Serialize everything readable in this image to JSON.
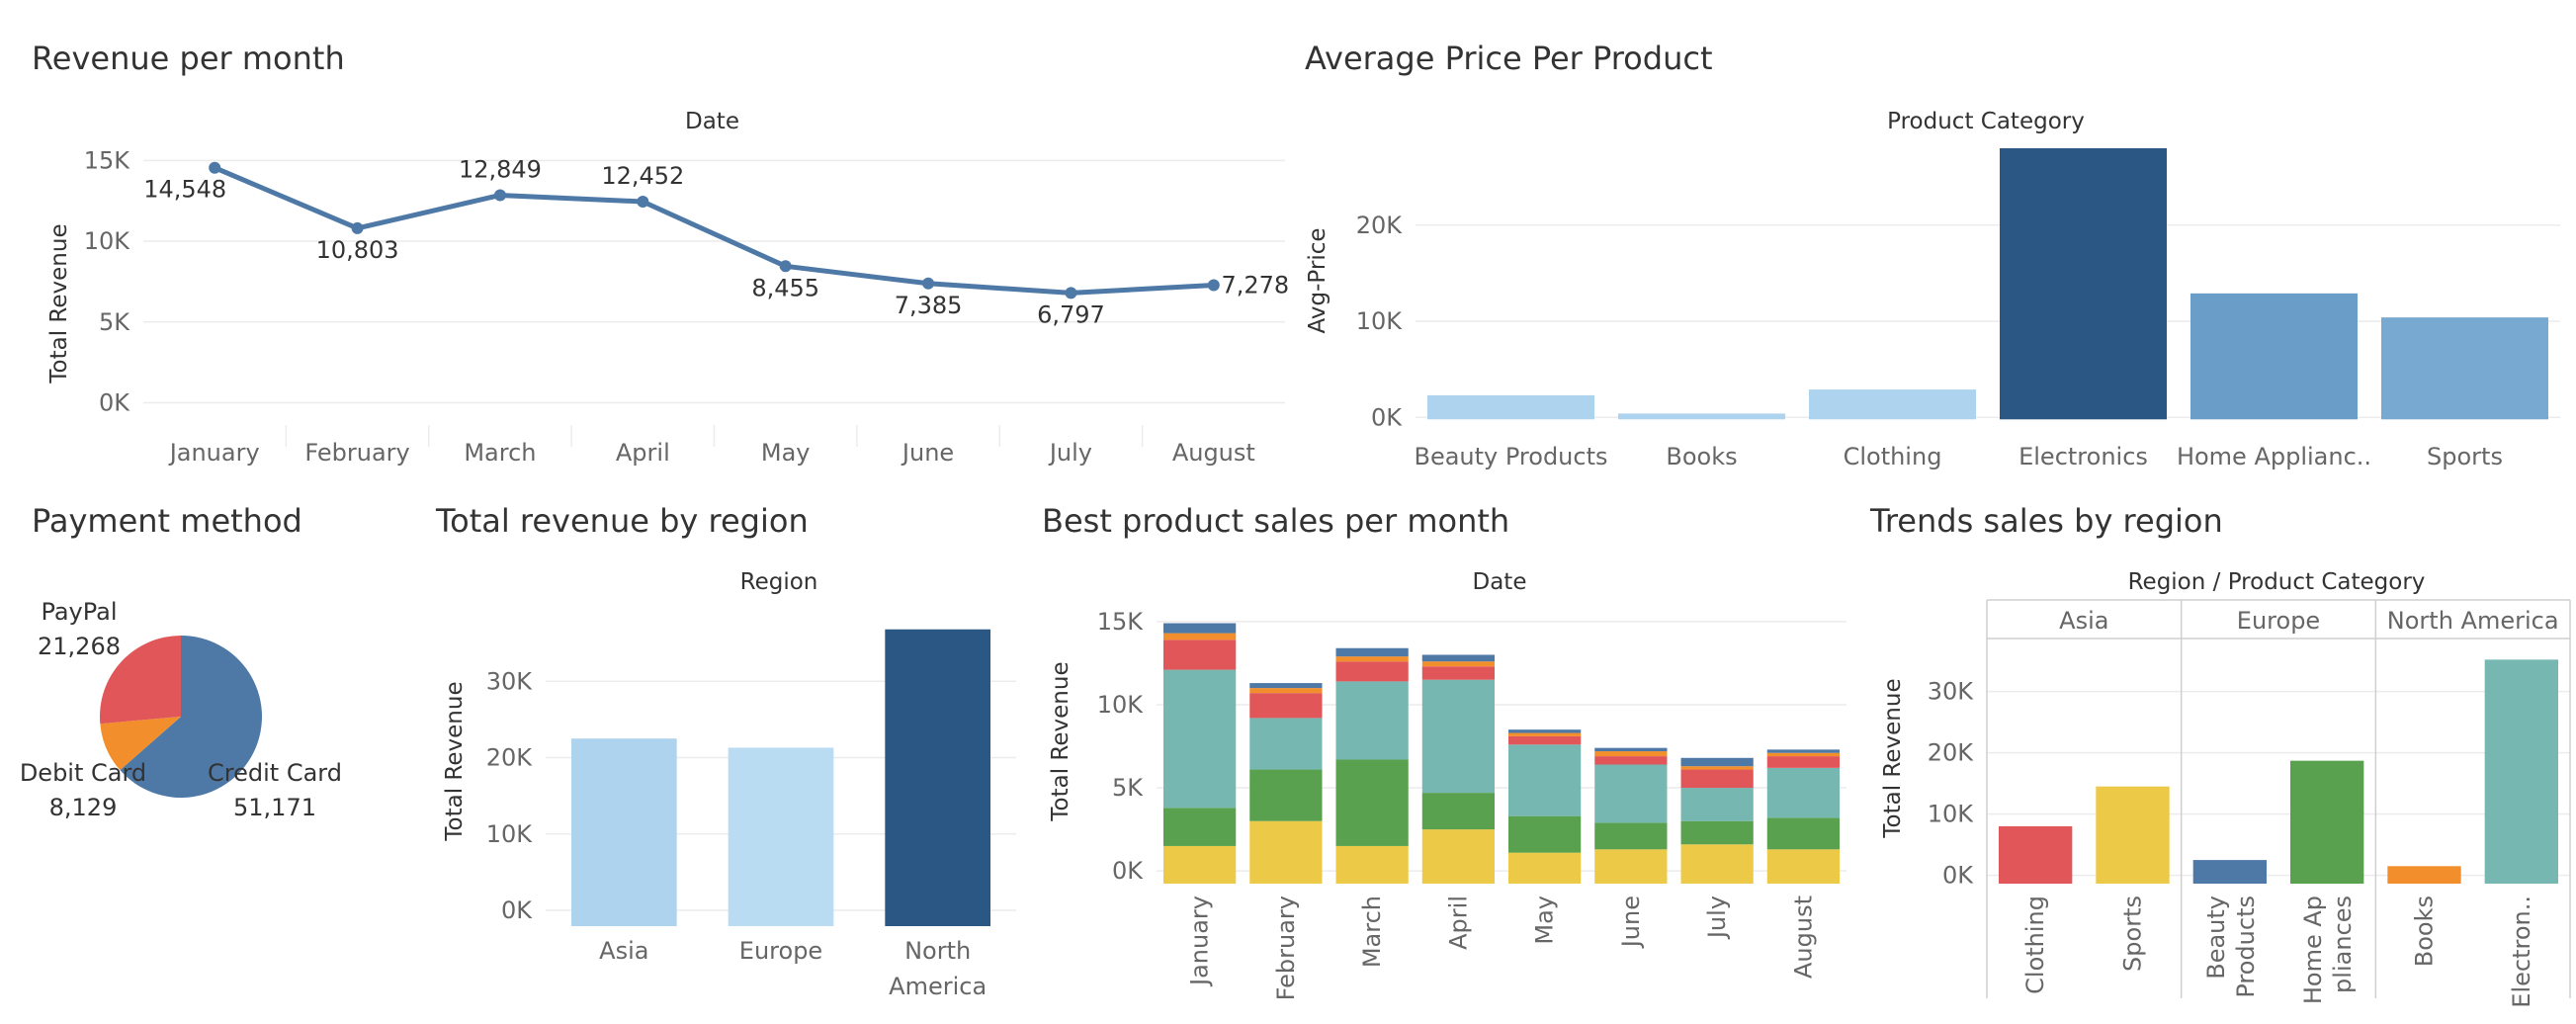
{
  "dashboard": {
    "colors": {
      "line": "#4e79a7",
      "dark_blue": "#2b5784",
      "mid_blue": "#6a9ec8",
      "light_blue": "#aed3ee",
      "grid": "#ececec",
      "pie_credit": "#4e79a7",
      "pie_debit": "#f28e2b",
      "pie_paypal": "#e15759"
    }
  },
  "chart_data": [
    {
      "id": "revenue-per-month",
      "type": "line",
      "title": "Revenue per month",
      "header": "Date",
      "ylabel": "Total Revenue",
      "categories": [
        "January",
        "February",
        "March",
        "April",
        "May",
        "June",
        "July",
        "August"
      ],
      "values": [
        14548,
        10803,
        12849,
        12452,
        8455,
        7385,
        6797,
        7278
      ],
      "labels": [
        "14,548",
        "10,803",
        "12,849",
        "12,452",
        "8,455",
        "7,385",
        "6,797",
        "7,278"
      ],
      "yticks": [
        "0K",
        "5K",
        "10K",
        "15K"
      ],
      "ylim": [
        -1500,
        16000
      ],
      "grid": true
    },
    {
      "id": "avg-price-per-product",
      "type": "bar",
      "title": "Average Price Per Product",
      "header": "Product Category",
      "ylabel": "Avg-Price",
      "categories": [
        "Beauty Products",
        "Books",
        "Clothing",
        "Electronics",
        "Home Applianc..",
        "Sports"
      ],
      "values": [
        2300,
        400,
        2900,
        28000,
        12900,
        10400
      ],
      "yticks": [
        "0K",
        "10K",
        "20K"
      ],
      "ylim": [
        -1000,
        28000
      ],
      "grid": true
    },
    {
      "id": "payment-method",
      "type": "pie",
      "title": "Payment method",
      "slices": [
        {
          "name": "Credit Card",
          "value": 51171,
          "label": "51,171"
        },
        {
          "name": "Debit Card",
          "value": 8129,
          "label": "8,129"
        },
        {
          "name": "PayPal",
          "value": 21268,
          "label": "21,268"
        }
      ]
    },
    {
      "id": "total-revenue-by-region",
      "type": "bar",
      "title": "Total revenue by region",
      "header": "Region",
      "ylabel": "Total Revenue",
      "categories": [
        "Asia",
        "Europe",
        "North America"
      ],
      "category_lines": [
        [
          "Asia"
        ],
        [
          "Europe"
        ],
        [
          "North",
          "America"
        ]
      ],
      "values": [
        22500,
        21300,
        36800
      ],
      "yticks": [
        "0K",
        "10K",
        "20K",
        "30K"
      ],
      "ylim": [
        -2200,
        40000
      ],
      "grid": true
    },
    {
      "id": "best-product-sales-per-month",
      "type": "bar",
      "stacked": true,
      "title": "Best product sales per month",
      "header": "Date",
      "ylabel": "Total Revenue",
      "categories": [
        "January",
        "February",
        "March",
        "April",
        "May",
        "June",
        "July",
        "August"
      ],
      "series": [
        {
          "color": "#edc948",
          "values": [
            1500,
            3000,
            1500,
            2500,
            1100,
            1300,
            1600,
            1300
          ]
        },
        {
          "color": "#59a14f",
          "values": [
            2300,
            3100,
            5200,
            2200,
            2200,
            1600,
            1400,
            1900
          ]
        },
        {
          "color": "#76b7b2",
          "values": [
            8300,
            3100,
            4700,
            6800,
            4300,
            3500,
            2000,
            3000
          ]
        },
        {
          "color": "#e15759",
          "values": [
            1800,
            1500,
            1200,
            800,
            500,
            500,
            1100,
            700
          ]
        },
        {
          "color": "#f28e2b",
          "values": [
            400,
            300,
            300,
            300,
            200,
            300,
            200,
            200
          ]
        },
        {
          "color": "#4e79a7",
          "values": [
            600,
            300,
            500,
            400,
            200,
            200,
            500,
            200
          ]
        }
      ],
      "yticks": [
        "0K",
        "5K",
        "10K",
        "15K"
      ],
      "ylim": [
        -1000,
        16000
      ],
      "grid": true
    },
    {
      "id": "trends-sales-by-region",
      "type": "bar",
      "title": "Trends sales by region",
      "header": "Region / Product Category",
      "ylabel": "Total Revenue",
      "groups": [
        {
          "region": "Asia",
          "items": [
            {
              "category": "Clothing",
              "lines": [
                "Clothing"
              ],
              "value": 8000,
              "color": "#e15759"
            },
            {
              "category": "Sports",
              "lines": [
                "Sports"
              ],
              "value": 14500,
              "color": "#edc948"
            }
          ]
        },
        {
          "region": "Europe",
          "items": [
            {
              "category": "Beauty Products",
              "lines": [
                "Beauty",
                "Products"
              ],
              "value": 2500,
              "color": "#4e79a7"
            },
            {
              "category": "Home Appliances",
              "lines": [
                "Home Ap",
                "pliances"
              ],
              "value": 18700,
              "color": "#59a14f"
            }
          ]
        },
        {
          "region": "North America",
          "items": [
            {
              "category": "Books",
              "lines": [
                "Books"
              ],
              "value": 1500,
              "color": "#f28e2b"
            },
            {
              "category": "Electronics",
              "lines": [
                "Electron.."
              ],
              "value": 35200,
              "color": "#76b7b2"
            }
          ]
        }
      ],
      "yticks": [
        "0K",
        "10K",
        "20K",
        "30K"
      ],
      "ylim": [
        -2000,
        38000
      ],
      "grid": true
    }
  ]
}
